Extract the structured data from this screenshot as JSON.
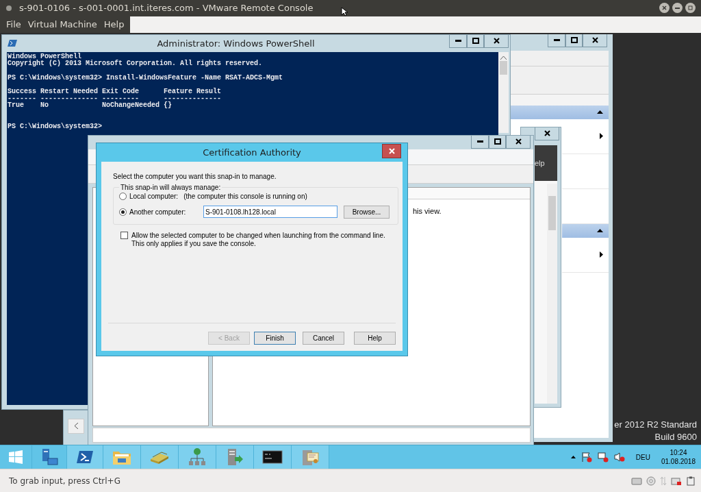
{
  "host": {
    "title": "s-901-0106 - s-001-0001.int.iteres.com - VMware Remote Console",
    "menu": [
      "File",
      "Virtual Machine",
      "Help"
    ],
    "status": "To grab input, press Ctrl+G"
  },
  "desktop": {
    "edition_text": "er 2012 R2 Standard",
    "build_text": "Build 9600"
  },
  "partial_window": {
    "label": "elp"
  },
  "powershell": {
    "title": "Administrator: Windows PowerShell",
    "blocks": [
      [
        "Windows PowerShell",
        "Copyright (C) 2013 Microsoft Corporation. All rights reserved."
      ],
      [
        "PS C:\\Windows\\system32> Install-WindowsFeature -Name RSAT-ADCS-Mgmt"
      ],
      [
        "Success Restart Needed Exit Code      Feature Result",
        "------- -------------- ---------      --------------",
        "True    No             NoChangeNeeded {}"
      ],
      [
        "PS C:\\Windows\\system32>"
      ]
    ]
  },
  "certsrv": {
    "pane_text": "his view."
  },
  "dialog": {
    "title": "Certification Authority",
    "intro": "Select the computer you want this snap-in to manage.",
    "group_label": "This snap-in will always manage:",
    "options": [
      {
        "label": "Local computer:",
        "hint": "(the computer this console is running on)",
        "selected": false
      },
      {
        "label": "Another computer:",
        "selected": true
      }
    ],
    "computer_name": "S-901-0108.lh128.local",
    "browse": "Browse...",
    "allow": {
      "label": "Allow the selected computer to be changed when launching from the command line. This only applies if you save the console.",
      "checked": false
    },
    "buttons": [
      {
        "label": "< Back",
        "disabled": true,
        "default": false
      },
      {
        "label": "Finish",
        "disabled": false,
        "default": true
      },
      {
        "label": "Cancel",
        "disabled": false,
        "default": false
      },
      {
        "label": "Help",
        "disabled": false,
        "default": false
      }
    ]
  },
  "taskbar": {
    "apps": [
      {
        "kind": "server"
      },
      {
        "kind": "powershell"
      },
      {
        "kind": "folder"
      },
      {
        "kind": "books"
      },
      {
        "kind": "network"
      },
      {
        "kind": "servers"
      },
      {
        "kind": "console"
      },
      {
        "kind": "certificate"
      }
    ],
    "language": "DEU",
    "time": "10:24",
    "date": "01.08.2018"
  }
}
